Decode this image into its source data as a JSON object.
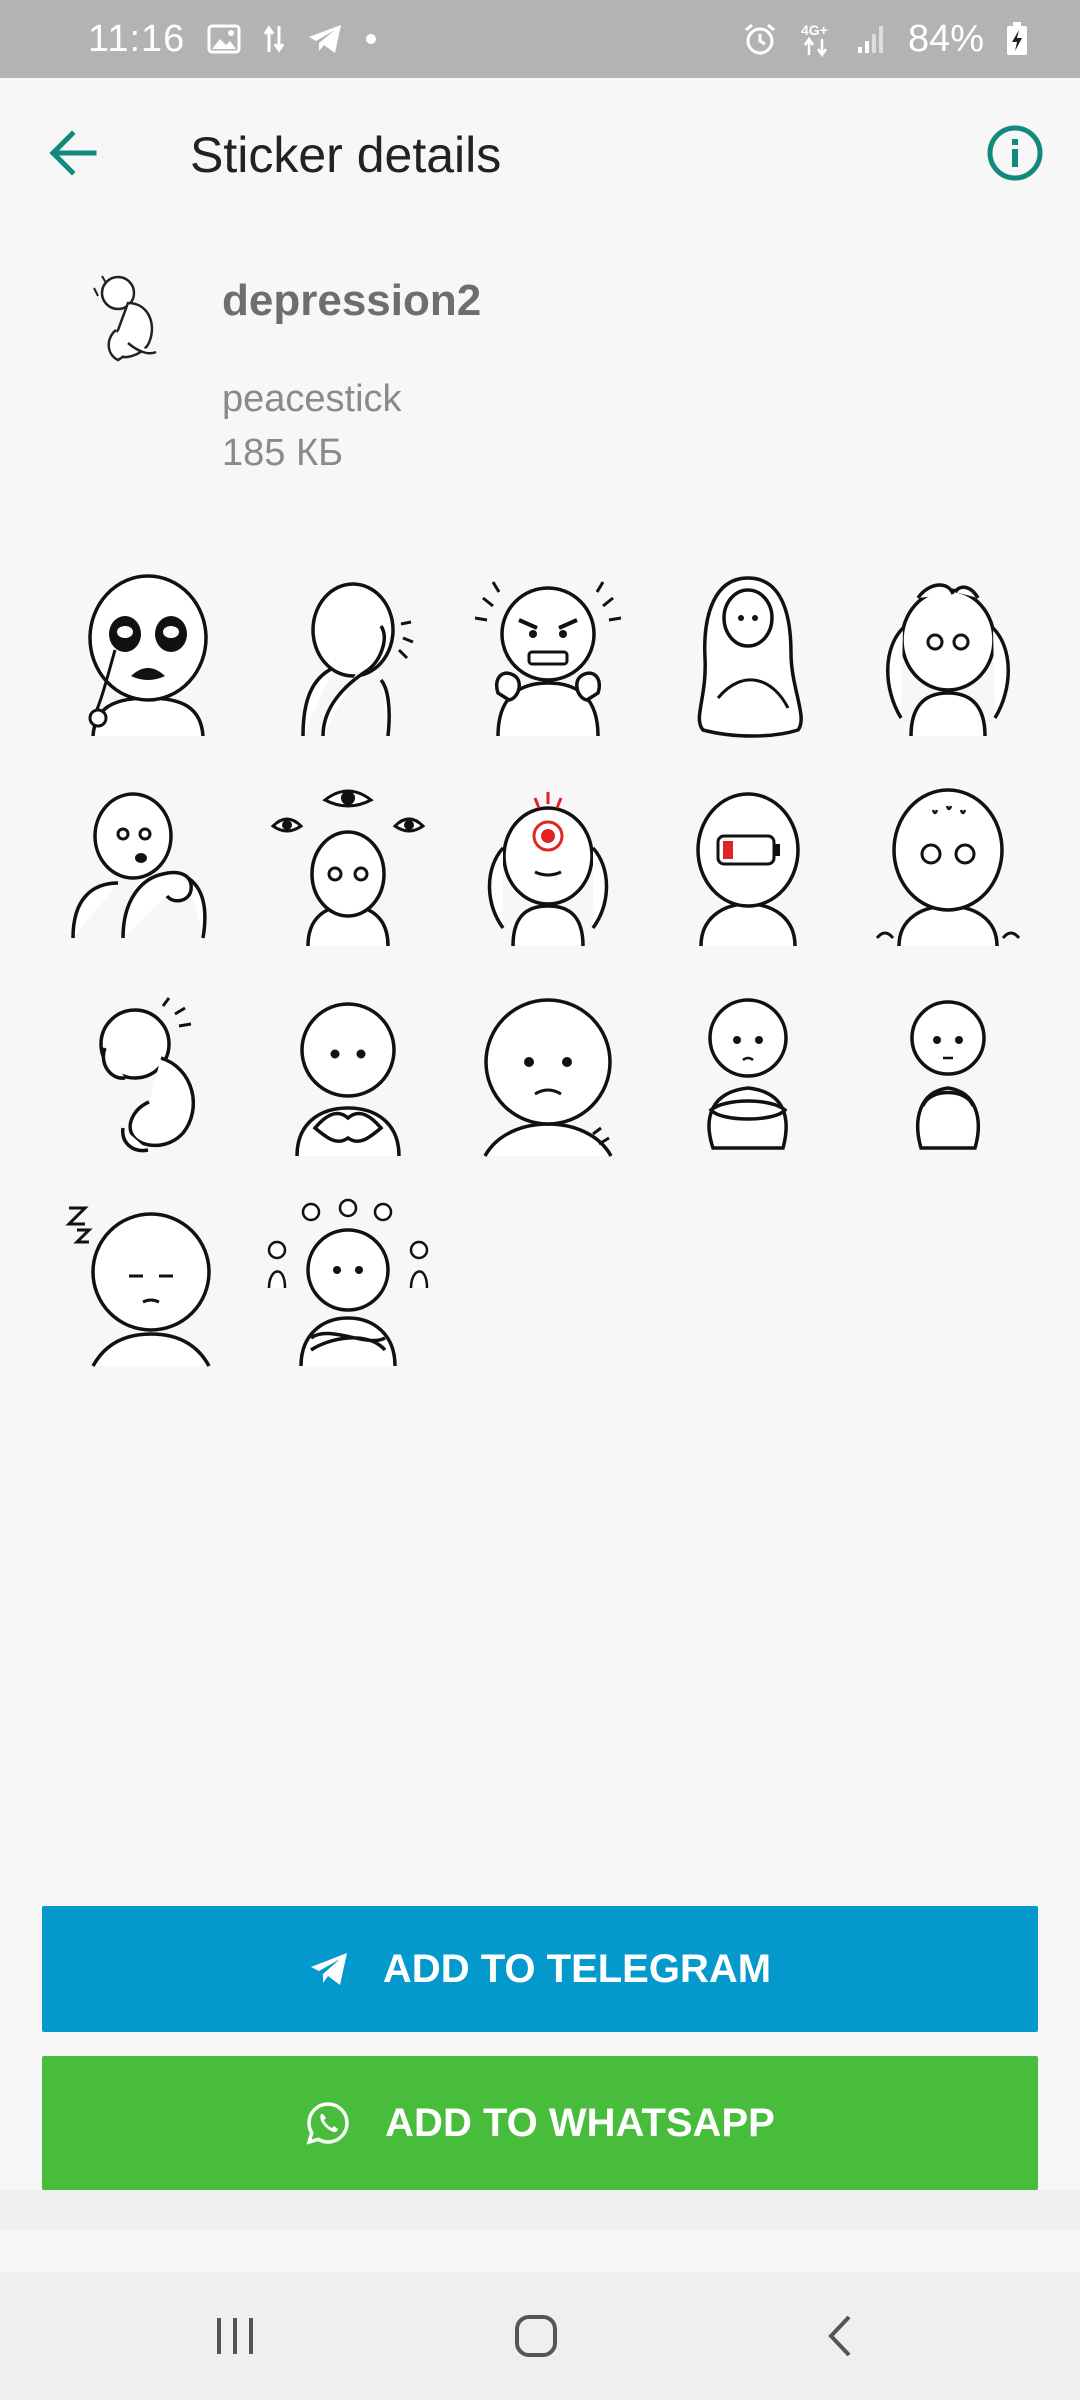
{
  "status_bar": {
    "time": "11:16",
    "battery_percent": "84%",
    "network_label": "4G+",
    "icons": [
      "gallery-icon",
      "data-transfer-icon",
      "telegram-icon",
      "dot-icon",
      "alarm-icon",
      "network-4g-icon",
      "signal-icon",
      "battery-charging-icon"
    ]
  },
  "app_bar": {
    "title": "Sticker details",
    "back_icon": "arrow-left-icon",
    "info_icon": "info-icon",
    "accent_color": "#0f8a7c"
  },
  "pack": {
    "name": "depression2",
    "author": "peacestick",
    "size": "185 КБ"
  },
  "stickers": [
    {
      "id": "crying-face"
    },
    {
      "id": "facepalm"
    },
    {
      "id": "angry-fists"
    },
    {
      "id": "blanket-wrap"
    },
    {
      "id": "head-in-hands"
    },
    {
      "id": "nail-biting"
    },
    {
      "id": "watched-by-eyes"
    },
    {
      "id": "headache-target"
    },
    {
      "id": "low-battery"
    },
    {
      "id": "shivering"
    },
    {
      "id": "curled-up-lying"
    },
    {
      "id": "hands-together"
    },
    {
      "id": "sad-face"
    },
    {
      "id": "sitting-hug-knees"
    },
    {
      "id": "sitting-knees"
    },
    {
      "id": "sleeping-zzz"
    },
    {
      "id": "crowd-arms-crossed"
    }
  ],
  "buttons": {
    "telegram_label": "ADD TO TELEGRAM",
    "whatsapp_label": "ADD TO WHATSAPP",
    "telegram_color": "#0399cc",
    "whatsapp_color": "#47bd3b"
  },
  "nav_bar": {
    "items": [
      "recents-icon",
      "home-icon",
      "back-icon"
    ]
  }
}
